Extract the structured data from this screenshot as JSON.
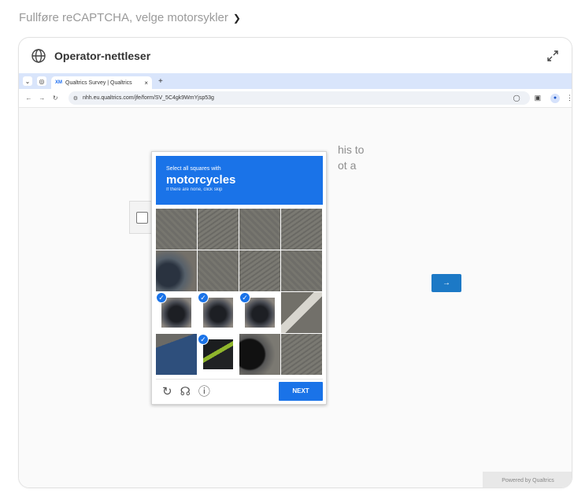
{
  "task": {
    "title": "Fullføre reCAPTCHA, velge motorsykler"
  },
  "operator": {
    "title": "Operator-nettleser"
  },
  "browser": {
    "tab_label": "Qualtrics Survey | Qualtrics",
    "tab_logo": "XM",
    "url": "nhh.eu.qualtrics.com/jfe/form/SV_5C4gk9WmYjsp53g"
  },
  "survey": {
    "text_line1": "his to",
    "text_line2": "ot a",
    "next_arrow": "→",
    "powered_by": "Powered by Qualtrics"
  },
  "captcha": {
    "instruction": "Select all squares with",
    "target": "motorcycles",
    "hint": "If there are none, click skip",
    "next_label": "NEXT",
    "selected_cells": [
      8,
      9,
      10,
      13
    ],
    "footer_icons": [
      "reload-icon",
      "headphones-icon",
      "info-icon"
    ]
  },
  "colors": {
    "accent": "#1a73e8",
    "tabstrip": "#d9e5fb"
  }
}
